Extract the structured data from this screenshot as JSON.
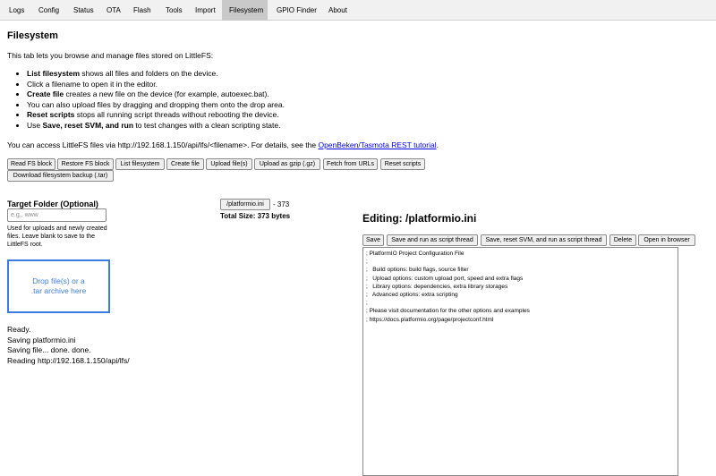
{
  "tabs": [
    {
      "label": "Logs",
      "active": false
    },
    {
      "label": "Config",
      "active": false
    },
    {
      "label": "Status",
      "active": false
    },
    {
      "label": "OTA",
      "active": false
    },
    {
      "label": "Flash",
      "active": false
    },
    {
      "label": "Tools",
      "active": false
    },
    {
      "label": "Import",
      "active": false
    },
    {
      "label": "Filesystem",
      "active": true
    },
    {
      "label": "GPIO Finder",
      "active": false
    },
    {
      "label": "About",
      "active": false
    }
  ],
  "page": {
    "title": "Filesystem",
    "intro": "This tab lets you browse and manage files stored on LittleFS:",
    "help": [
      {
        "bold": "List filesystem",
        "text": " shows all files and folders on the device."
      },
      {
        "bold": "",
        "text": "Click a filename to open it in the editor."
      },
      {
        "bold": "Create file",
        "text": " creates a new file on the device (for example, autoexec.bat)."
      },
      {
        "bold": "",
        "text": "You can also upload files by dragging and dropping them onto the drop area."
      },
      {
        "bold": "Reset scripts",
        "text": " stops all running script threads without rebooting the device."
      },
      {
        "bold_prefix": "Use ",
        "bold": "Save, reset SVM, and run",
        "text": " to test changes with a clean scripting state."
      }
    ],
    "access_text": "You can access LittleFS files via http://192.168.1.150/api/lfs/<filename>. For details, see the ",
    "access_link": "OpenBeken/Tasmota REST tutorial",
    "access_end": "."
  },
  "toolbar": {
    "read_fs_block": "Read FS block",
    "restore_fs_block": "Restore FS block",
    "list_filesystem": "List filesystem",
    "create_file": "Create file",
    "upload_files": "Upload file(s)",
    "upload_gzip": "Upload as gzip (.gz)",
    "fetch_urls": "Fetch from URLs",
    "reset_scripts": "Reset scripts",
    "download_backup": "Download filesystem backup (.tar)"
  },
  "upload": {
    "target_folder_label": "Target Folder (Optional)",
    "target_folder_placeholder": "e.g., www",
    "target_folder_value": "",
    "hint": "Used for uploads and newly created files. Leave blank to save to the LittleFS root.",
    "dropzone": "Drop file(s) or a .tar archive here"
  },
  "log": [
    "Ready.",
    "Saving platformio.ini",
    "Saving file... done. done.",
    "Reading http://192.168.1.150/api/lfs/"
  ],
  "files": {
    "items": [
      {
        "name": "/platformio.ini",
        "size_text": "- 373"
      }
    ],
    "total": "Total Size: 373 bytes"
  },
  "editor": {
    "heading": "Editing: /platformio.ini",
    "save": "Save",
    "save_run": "Save and run as script thread",
    "save_reset_run": "Save, reset SVM, and run as script thread",
    "delete": "Delete",
    "open_browser": "Open in browser",
    "content": "; PlatformIO Project Configuration File\n;\n;   Build options: build flags, source filter\n;   Upload options: custom upload port, speed and extra flags\n;   Library options: dependencies, extra library storages\n;   Advanced options: extra scripting\n;\n; Please visit documentation for the other options and examples\n; https://docs.platformio.org/page/projectconf.html"
  },
  "colors": {
    "tab_active_bg": "#c9c9c9",
    "tabbar_bg": "#f1f1f1",
    "link": "#0000ee",
    "dropzone": "#3d7de0"
  }
}
